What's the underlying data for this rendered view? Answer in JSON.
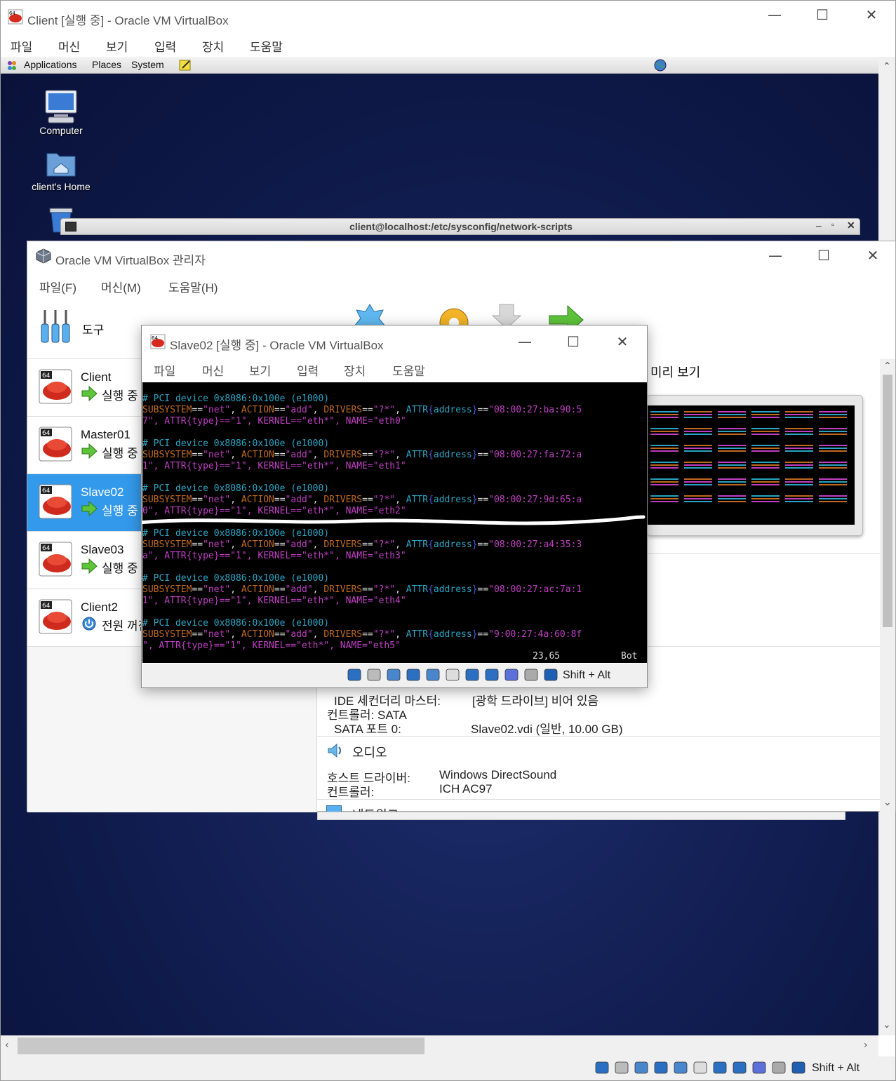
{
  "outer": {
    "title": "Client [실행 중] - Oracle VM VirtualBox",
    "menu": [
      "파일",
      "머신",
      "보기",
      "입력",
      "장치",
      "도움말"
    ],
    "status_keys": "Shift +  Alt"
  },
  "gnome_panel": {
    "applications": "Applications",
    "places": "Places",
    "system": "System"
  },
  "desktop": {
    "computer_label": "Computer",
    "home_label": "client's Home"
  },
  "terminal": {
    "title": "client@localhost:/etc/sysconfig/network-scripts"
  },
  "manager": {
    "title": "Oracle VM VirtualBox 관리자",
    "menu": [
      "파일(F)",
      "머신(M)",
      "도움말(H)"
    ],
    "tools_label": "도구",
    "preview_label": "미리 보기",
    "vms": [
      {
        "name": "Client",
        "state": "실행 중",
        "status": "running"
      },
      {
        "name": "Master01",
        "state": "실행 중",
        "status": "running"
      },
      {
        "name": "Slave02",
        "state": "실행 중",
        "status": "running"
      },
      {
        "name": "Slave03",
        "state": "실행 중",
        "status": "running"
      },
      {
        "name": "Client2",
        "state": "전원 꺼짐",
        "status": "off"
      }
    ],
    "storage": {
      "ide_secondary_label": "IDE 세컨더리 마스터:",
      "ide_secondary_value": "[광학 드라이브] 비어 있음",
      "controller_sata": "컨트롤러: SATA",
      "sata_port_label": "SATA 포트 0:",
      "sata_port_value": "Slave02.vdi (일반, 10.00 GB)"
    },
    "audio": {
      "heading": "오디오",
      "host_driver_label": "호스트 드라이버:",
      "host_driver_value": "Windows DirectSound",
      "controller_label": "컨트롤러:",
      "controller_value": "ICH AC97"
    },
    "network_heading": "네트워크"
  },
  "slave": {
    "title": "Slave02 [실행 중] - Oracle VM VirtualBox",
    "menu": [
      "파일",
      "머신",
      "보기",
      "입력",
      "장치",
      "도움말"
    ],
    "status_keys": "Shift +  Alt",
    "console": [
      {
        "comment": "# PCI device 0x8086:0x100e (e1000)",
        "l1": {
          "pre": "SUBSYSTEM==\"net\", ACTION==\"add\", DRIVERS==\"?*\", ATTR{address}==\"08:00:27:ba:90:5"
        },
        "l2": {
          "pre": "7\", ATTR{type}==\"1\", KERNEL==\"eth*\", NAME=\"eth0\""
        }
      },
      {
        "comment": "# PCI device 0x8086:0x100e (e1000)",
        "l1": {
          "pre": "SUBSYSTEM==\"net\", ACTION==\"add\", DRIVERS==\"?*\", ATTR{address}==\"08:00:27:fa:72:a"
        },
        "l2": {
          "pre": "1\", ATTR{type}==\"1\", KERNEL==\"eth*\", NAME=\"eth1\""
        }
      },
      {
        "comment": "# PCI device 0x8086:0x100e (e1000)",
        "l1": {
          "pre": "SUBSYSTEM==\"net\", ACTION==\"add\", DRIVERS==\"?*\", ATTR{address}==\"08:00:27:9d:65:a"
        },
        "l2": {
          "pre": "0\", ATTR{type}==\"1\", KERNEL==\"eth*\", NAME=\"eth2\""
        }
      },
      {
        "comment": "# PCI device 0x8086:0x100e (e1000)",
        "l1": {
          "pre": "SUBSYSTEM==\"net\", ACTION==\"add\", DRIVERS==\"?*\", ATTR{address}==\"08:00:27:a4:35:3"
        },
        "l2": {
          "pre": "a\", ATTR{type}==\"1\", KERNEL==\"eth*\", NAME=\"eth3\""
        }
      },
      {
        "comment": "# PCI device 0x8086:0x100e (e1000)",
        "l1": {
          "pre": "SUBSYSTEM==\"net\", ACTION==\"add\", DRIVERS==\"?*\", ATTR{address}==\"08:00:27:ac:7a:1"
        },
        "l2": {
          "pre": "1\", ATTR{type}==\"1\", KERNEL==\"eth*\", NAME=\"eth4\""
        }
      },
      {
        "comment": "# PCI device 0x8086:0x100e (e1000)",
        "l1": {
          "pre": "SUBSYSTEM==\"net\", ACTION==\"add\", DRIVERS==\"?*\", ATTR{address}==\"9:00:27:4a:60:8f"
        },
        "l2": {
          "pre": "\", ATTR{type}==\"1\", KERNEL==\"eth*\", NAME=\"eth5\""
        }
      }
    ],
    "cursor_pos": "23,65",
    "scroll_pos": "Bot"
  },
  "colors": {
    "selected": "#3399ea",
    "console_blue": "#2aa4c2",
    "console_orange": "#c06a1e",
    "console_magenta": "#c13ec3"
  }
}
